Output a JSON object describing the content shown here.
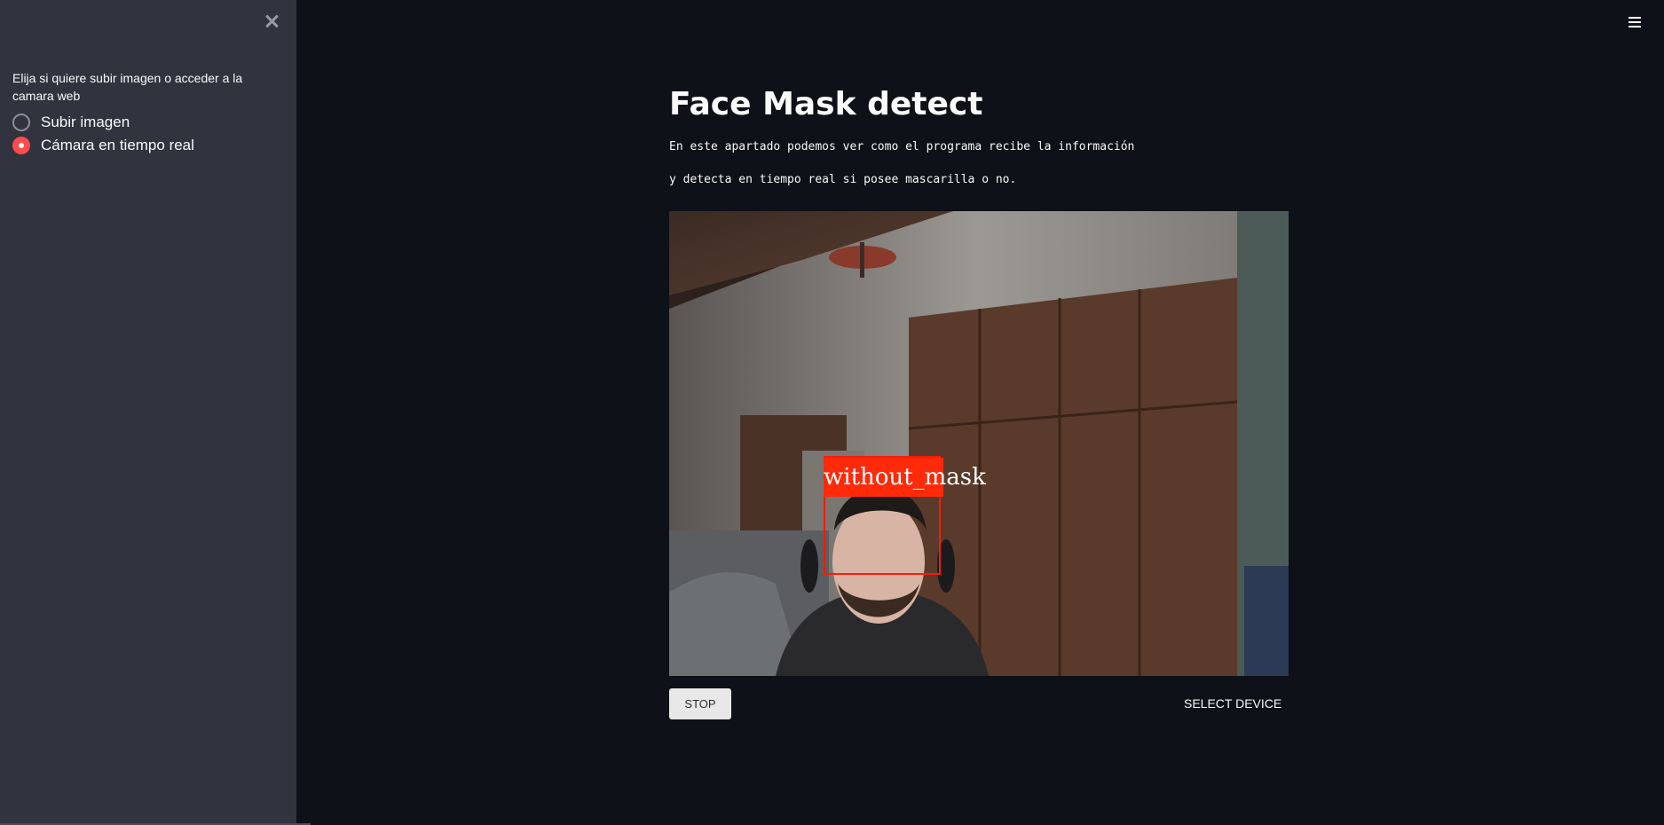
{
  "sidebar": {
    "question": "Elija si quiere subir imagen o acceder a la camara web",
    "options": [
      {
        "label": "Subir imagen",
        "selected": false
      },
      {
        "label": "Cámara en tiempo real",
        "selected": true
      }
    ]
  },
  "main": {
    "title": "Face Mask detect",
    "description_line1": "En este apartado podemos ver como el programa recibe la información",
    "description_line2": "y detecta en tiempo real si posee mascarilla o no.",
    "detection_label": "without_mask"
  },
  "controls": {
    "stop_label": "STOP",
    "select_device_label": "SELECT DEVICE"
  },
  "colors": {
    "accent": "#ff4b4b",
    "detection_box": "#ff1a0a"
  },
  "icons": [
    "close-icon",
    "hamburger-menu-icon"
  ]
}
